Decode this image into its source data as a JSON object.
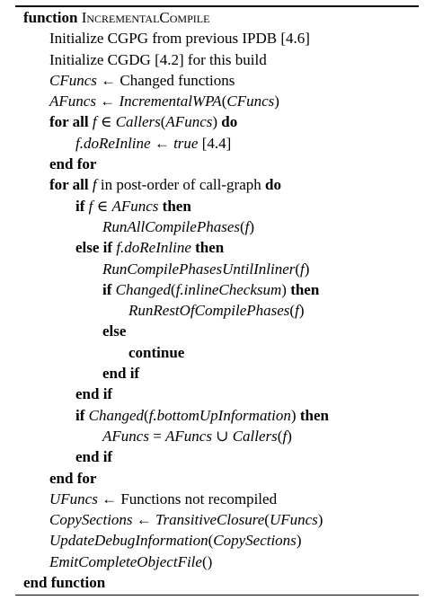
{
  "algorithm": {
    "lines": [
      {
        "indent": 0,
        "segments": [
          {
            "t": "function",
            "s": "kw"
          },
          {
            "t": " ",
            "s": ""
          },
          {
            "t": "IncrementalCompile",
            "s": "sc"
          }
        ]
      },
      {
        "indent": 1,
        "segments": [
          {
            "t": "Initialize CGPG from previous IPDB [4.6]",
            "s": ""
          }
        ]
      },
      {
        "indent": 1,
        "segments": [
          {
            "t": "Initialize CGDG [4.2] for this build",
            "s": ""
          }
        ]
      },
      {
        "indent": 1,
        "segments": [
          {
            "t": "CFuncs",
            "s": "m"
          },
          {
            "t": " ← Changed functions",
            "s": ""
          }
        ]
      },
      {
        "indent": 1,
        "segments": [
          {
            "t": "AFuncs",
            "s": "m"
          },
          {
            "t": " ← ",
            "s": ""
          },
          {
            "t": "IncrementalWPA",
            "s": "m"
          },
          {
            "t": "(",
            "s": ""
          },
          {
            "t": "CFuncs",
            "s": "m"
          },
          {
            "t": ")",
            "s": ""
          }
        ]
      },
      {
        "indent": 1,
        "segments": [
          {
            "t": "for all",
            "s": "kw"
          },
          {
            "t": " ",
            "s": ""
          },
          {
            "t": "f",
            "s": "m"
          },
          {
            "t": " ∈ ",
            "s": ""
          },
          {
            "t": "Callers",
            "s": "m"
          },
          {
            "t": "(",
            "s": ""
          },
          {
            "t": "AFuncs",
            "s": "m"
          },
          {
            "t": ") ",
            "s": ""
          },
          {
            "t": "do",
            "s": "kw"
          }
        ]
      },
      {
        "indent": 2,
        "segments": [
          {
            "t": "f.doReInline",
            "s": "m"
          },
          {
            "t": " ← ",
            "s": ""
          },
          {
            "t": "true",
            "s": "m"
          },
          {
            "t": " [4.4]",
            "s": ""
          }
        ]
      },
      {
        "indent": 1,
        "segments": [
          {
            "t": "end for",
            "s": "kw"
          }
        ]
      },
      {
        "indent": 1,
        "segments": [
          {
            "t": "for all",
            "s": "kw"
          },
          {
            "t": " ",
            "s": ""
          },
          {
            "t": "f",
            "s": "m"
          },
          {
            "t": " in post-order of call-graph ",
            "s": ""
          },
          {
            "t": "do",
            "s": "kw"
          }
        ]
      },
      {
        "indent": 2,
        "segments": [
          {
            "t": "if",
            "s": "kw"
          },
          {
            "t": " ",
            "s": ""
          },
          {
            "t": "f",
            "s": "m"
          },
          {
            "t": " ∈ ",
            "s": ""
          },
          {
            "t": "AFuncs",
            "s": "m"
          },
          {
            "t": " ",
            "s": ""
          },
          {
            "t": "then",
            "s": "kw"
          }
        ]
      },
      {
        "indent": 3,
        "segments": [
          {
            "t": "RunAllCompilePhases",
            "s": "m"
          },
          {
            "t": "(",
            "s": ""
          },
          {
            "t": "f",
            "s": "m"
          },
          {
            "t": ")",
            "s": ""
          }
        ]
      },
      {
        "indent": 2,
        "segments": [
          {
            "t": "else if",
            "s": "kw"
          },
          {
            "t": " ",
            "s": ""
          },
          {
            "t": "f.doReInline",
            "s": "m"
          },
          {
            "t": " ",
            "s": ""
          },
          {
            "t": "then",
            "s": "kw"
          }
        ]
      },
      {
        "indent": 3,
        "segments": [
          {
            "t": "RunCompilePhasesUntilInliner",
            "s": "m"
          },
          {
            "t": "(",
            "s": ""
          },
          {
            "t": "f",
            "s": "m"
          },
          {
            "t": ")",
            "s": ""
          }
        ]
      },
      {
        "indent": 3,
        "segments": [
          {
            "t": "if",
            "s": "kw"
          },
          {
            "t": " ",
            "s": ""
          },
          {
            "t": "Changed",
            "s": "m"
          },
          {
            "t": "(",
            "s": ""
          },
          {
            "t": "f.inlineChecksum",
            "s": "m"
          },
          {
            "t": ") ",
            "s": ""
          },
          {
            "t": "then",
            "s": "kw"
          }
        ]
      },
      {
        "indent": 4,
        "segments": [
          {
            "t": "RunRestOfCompilePhases",
            "s": "m"
          },
          {
            "t": "(",
            "s": ""
          },
          {
            "t": "f",
            "s": "m"
          },
          {
            "t": ")",
            "s": ""
          }
        ]
      },
      {
        "indent": 3,
        "segments": [
          {
            "t": "else",
            "s": "kw"
          }
        ]
      },
      {
        "indent": 4,
        "segments": [
          {
            "t": "continue",
            "s": "kw"
          }
        ]
      },
      {
        "indent": 3,
        "segments": [
          {
            "t": "end if",
            "s": "kw"
          }
        ]
      },
      {
        "indent": 2,
        "segments": [
          {
            "t": "end if",
            "s": "kw"
          }
        ]
      },
      {
        "indent": 2,
        "segments": [
          {
            "t": "if",
            "s": "kw"
          },
          {
            "t": " ",
            "s": ""
          },
          {
            "t": "Changed",
            "s": "m"
          },
          {
            "t": "(",
            "s": ""
          },
          {
            "t": "f.bottomUpInformation",
            "s": "m"
          },
          {
            "t": ") ",
            "s": ""
          },
          {
            "t": "then",
            "s": "kw"
          }
        ]
      },
      {
        "indent": 3,
        "segments": [
          {
            "t": "AFuncs",
            "s": "m"
          },
          {
            "t": " = ",
            "s": ""
          },
          {
            "t": "AFuncs",
            "s": "m"
          },
          {
            "t": " ∪ ",
            "s": ""
          },
          {
            "t": "Callers",
            "s": "m"
          },
          {
            "t": "(",
            "s": ""
          },
          {
            "t": "f",
            "s": "m"
          },
          {
            "t": ")",
            "s": ""
          }
        ]
      },
      {
        "indent": 2,
        "segments": [
          {
            "t": "end if",
            "s": "kw"
          }
        ]
      },
      {
        "indent": 1,
        "segments": [
          {
            "t": "end for",
            "s": "kw"
          }
        ]
      },
      {
        "indent": 1,
        "segments": [
          {
            "t": "UFuncs",
            "s": "m"
          },
          {
            "t": " ← Functions not recompiled",
            "s": ""
          }
        ]
      },
      {
        "indent": 1,
        "segments": [
          {
            "t": "CopySections",
            "s": "m"
          },
          {
            "t": " ← ",
            "s": ""
          },
          {
            "t": "TransitiveClosure",
            "s": "m"
          },
          {
            "t": "(",
            "s": ""
          },
          {
            "t": "UFuncs",
            "s": "m"
          },
          {
            "t": ")",
            "s": ""
          }
        ]
      },
      {
        "indent": 1,
        "segments": [
          {
            "t": "UpdateDebugInformation",
            "s": "m"
          },
          {
            "t": "(",
            "s": ""
          },
          {
            "t": "CopySections",
            "s": "m"
          },
          {
            "t": ")",
            "s": ""
          }
        ]
      },
      {
        "indent": 1,
        "segments": [
          {
            "t": "EmitCompleteObjectFile",
            "s": "m"
          },
          {
            "t": "()",
            "s": ""
          }
        ]
      },
      {
        "indent": 0,
        "segments": [
          {
            "t": "end function",
            "s": "kw"
          }
        ]
      }
    ]
  }
}
